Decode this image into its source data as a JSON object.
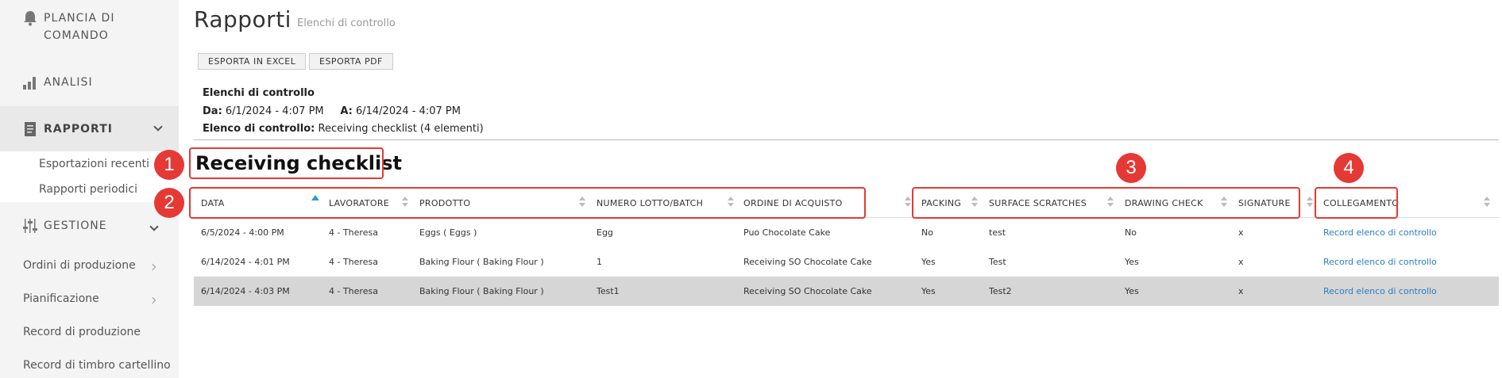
{
  "sidebar": {
    "dashboard": "PLANCIA DI COMANDO",
    "analisi": "ANALISI",
    "rapporti": "RAPPORTI",
    "sub_recent": "Esportazioni recenti",
    "sub_periodic": "Rapporti periodici",
    "gestione": "GESTIONE",
    "items": [
      "Ordini di produzione",
      "Pianificazione",
      "Record di produzione",
      "Record di timbro cartellino"
    ]
  },
  "header": {
    "title": "Rapporti",
    "subtitle": "Elenchi di controllo"
  },
  "toolbar": {
    "excel": "ESPORTA IN EXCEL",
    "pdf": "ESPORTA PDF"
  },
  "info": {
    "heading": "Elenchi di controllo",
    "from_label": "Da:",
    "from_value": "6/1/2024 - 4:07 PM",
    "to_label": "A:",
    "to_value": "6/14/2024 - 4:07 PM",
    "list_label": "Elenco di controllo:",
    "list_value": "Receiving checklist (4 elementi)"
  },
  "report_title": "Receiving checklist",
  "columns": [
    "DATA",
    "LAVORATORE",
    "PRODOTTO",
    "NUMERO LOTTO/BATCH",
    "ORDINE DI ACQUISTO",
    "PACKING",
    "SURFACE SCRATCHES",
    "DRAWING CHECK",
    "SIGNATURE",
    "COLLEGAMENTO"
  ],
  "rows": [
    [
      "6/5/2024 - 4:00 PM",
      "4 - Theresa",
      "Eggs ( Eggs )",
      "Egg",
      "Puo Chocolate Cake",
      "No",
      "test",
      "No",
      "x",
      "Record elenco di controllo"
    ],
    [
      "6/14/2024 - 4:01 PM",
      "4 - Theresa",
      "Baking Flour ( Baking Flour )",
      "1",
      "Receiving SO Chocolate Cake",
      "Yes",
      "Test",
      "Yes",
      "x",
      "Record elenco di controllo"
    ],
    [
      "6/14/2024 - 4:03 PM",
      "4 - Theresa",
      "Baking Flour ( Baking Flour )",
      "Test1",
      "Receiving SO Chocolate Cake",
      "Yes",
      "Test2",
      "Yes",
      "x",
      "Record elenco di controllo"
    ]
  ],
  "annotations": [
    "1",
    "2",
    "3",
    "4"
  ],
  "colors": {
    "annotation": "#e53935",
    "link": "#2a7fc0",
    "sort_active": "#2a9bd6",
    "selected_row": "#d6d6d6"
  }
}
